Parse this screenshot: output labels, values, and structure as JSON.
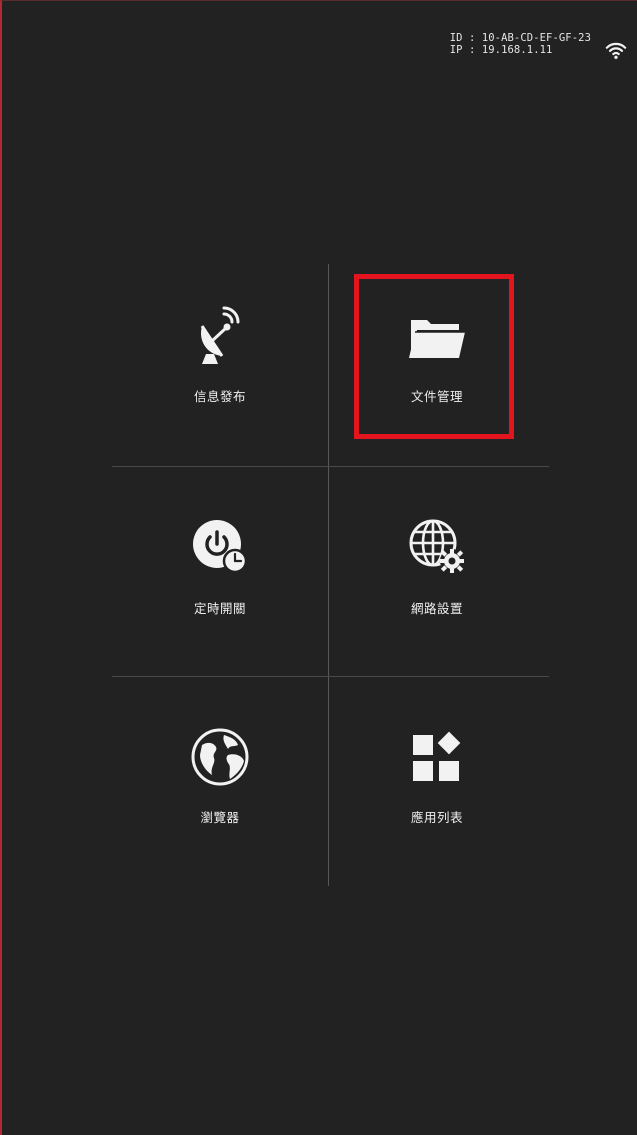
{
  "status": {
    "id_text": "ID : 10-AB-CD-EF-GF-23",
    "ip_text": "IP : 19.168.1.11",
    "wifi_icon": "wifi-icon"
  },
  "menu": {
    "tiles": [
      {
        "label": "信息發布",
        "icon": "satellite-dish-icon"
      },
      {
        "label": "文件管理",
        "icon": "folder-icon"
      },
      {
        "label": "定時開關",
        "icon": "power-timer-icon"
      },
      {
        "label": "網路設置",
        "icon": "globe-settings-icon"
      },
      {
        "label": "瀏覽器",
        "icon": "earth-icon"
      },
      {
        "label": "應用列表",
        "icon": "app-grid-icon"
      }
    ],
    "highlighted_index": 1
  },
  "colors": {
    "background": "#222222",
    "highlight": "#e3141d",
    "text": "#efefef"
  }
}
